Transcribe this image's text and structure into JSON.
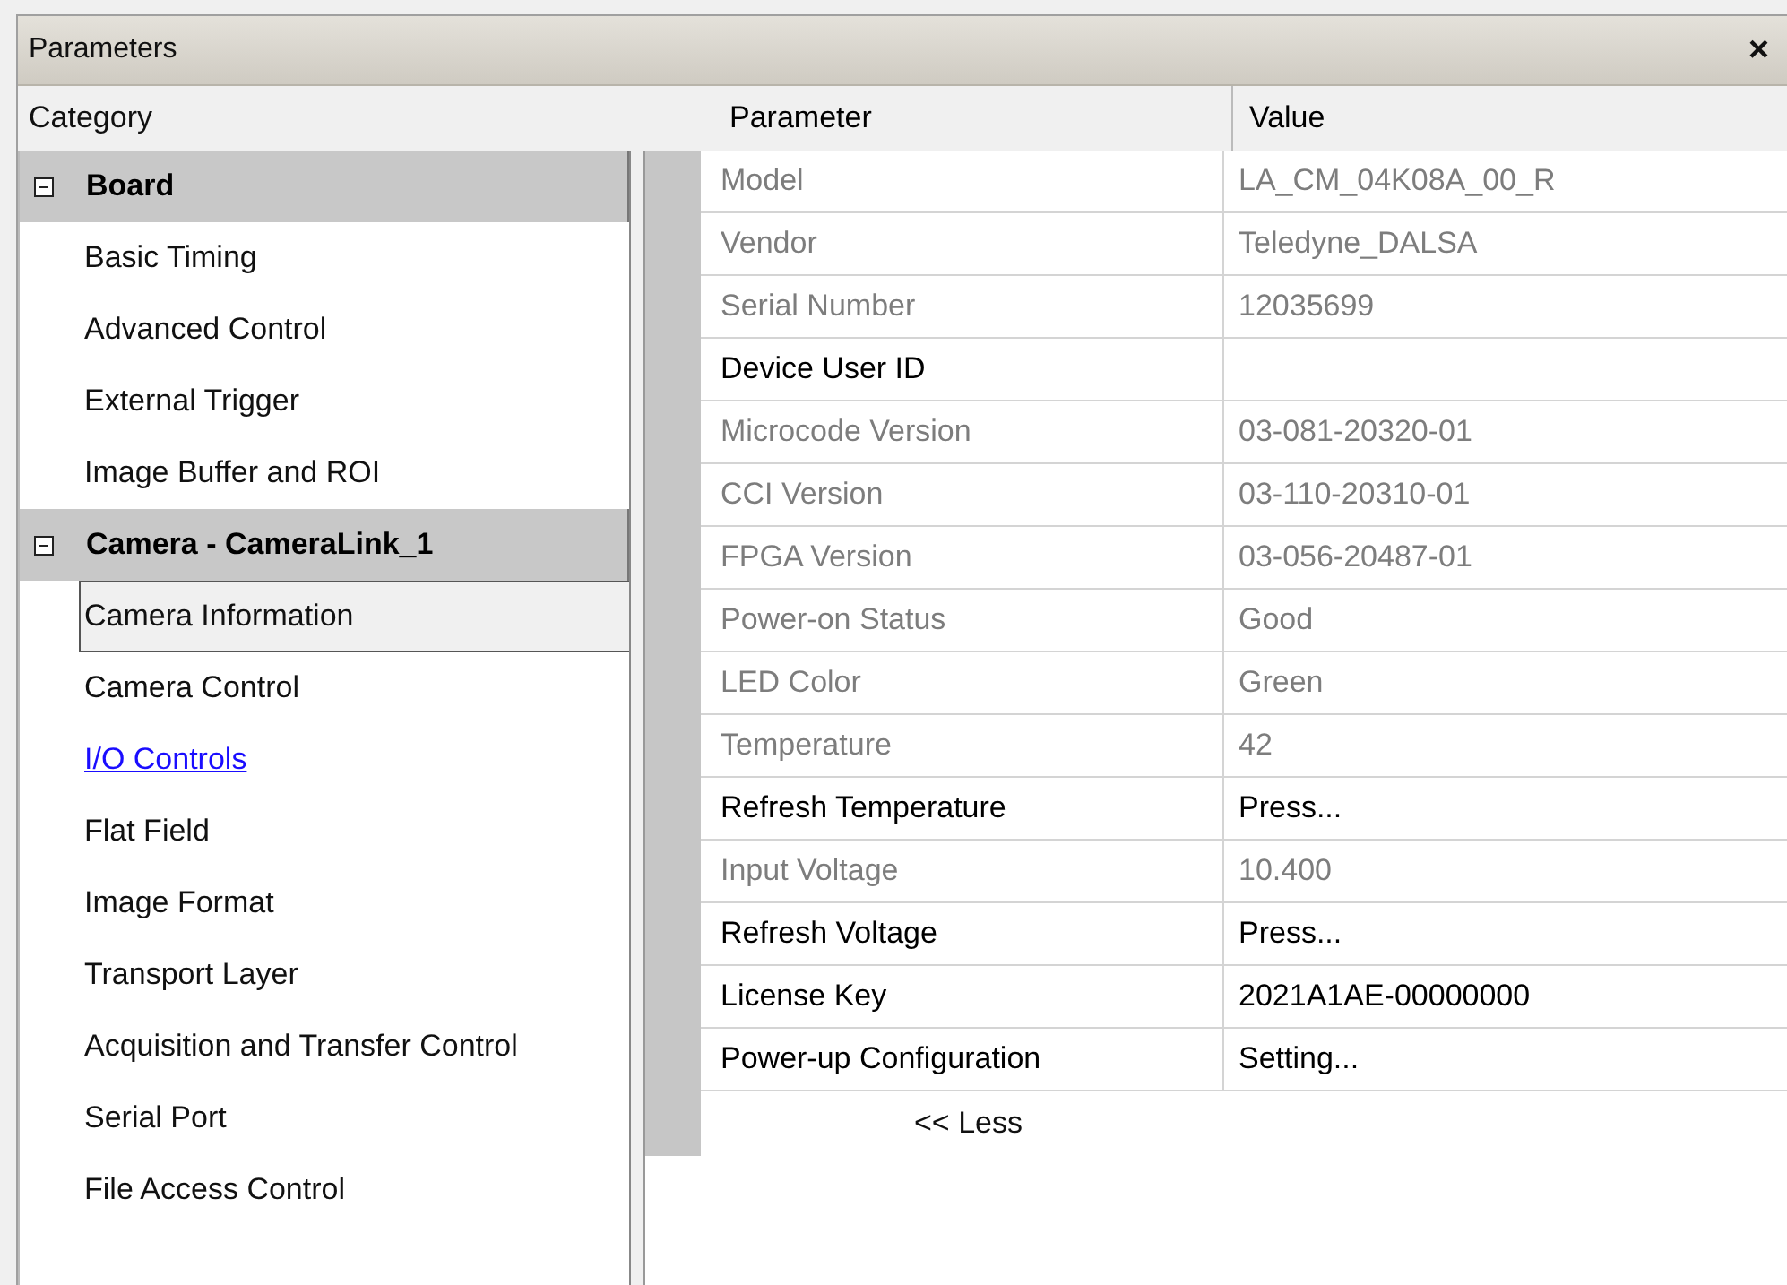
{
  "window": {
    "title": "Parameters",
    "close": "×"
  },
  "category_header": "Category",
  "groups": [
    {
      "label": "Board",
      "expanded": true,
      "items": [
        {
          "label": "Basic Timing",
          "selected": false,
          "hovered": false
        },
        {
          "label": "Advanced Control",
          "selected": false,
          "hovered": false
        },
        {
          "label": "External Trigger",
          "selected": false,
          "hovered": false
        },
        {
          "label": "Image Buffer and ROI",
          "selected": false,
          "hovered": false
        }
      ]
    },
    {
      "label": "Camera - CameraLink_1",
      "expanded": true,
      "items": [
        {
          "label": "Camera Information",
          "selected": true,
          "hovered": false
        },
        {
          "label": "Camera Control",
          "selected": false,
          "hovered": false
        },
        {
          "label": "I/O Controls ",
          "selected": false,
          "hovered": true
        },
        {
          "label": "Flat Field",
          "selected": false,
          "hovered": false
        },
        {
          "label": "Image Format",
          "selected": false,
          "hovered": false
        },
        {
          "label": "Transport Layer",
          "selected": false,
          "hovered": false
        },
        {
          "label": "Acquisition and Transfer Control",
          "selected": false,
          "hovered": false
        },
        {
          "label": "Serial Port",
          "selected": false,
          "hovered": false
        },
        {
          "label": "File Access Control",
          "selected": false,
          "hovered": false
        }
      ]
    }
  ],
  "table": {
    "columns": [
      "Parameter",
      "Value"
    ],
    "rows": [
      {
        "parameter": "Model",
        "value": "LA_CM_04K08A_00_R",
        "readonly": true
      },
      {
        "parameter": "Vendor",
        "value": "Teledyne_DALSA",
        "readonly": true
      },
      {
        "parameter": "Serial Number",
        "value": "12035699",
        "readonly": true
      },
      {
        "parameter": "Device User ID",
        "value": "",
        "readonly": false
      },
      {
        "parameter": "Microcode Version",
        "value": "03-081-20320-01",
        "readonly": true
      },
      {
        "parameter": "CCI Version",
        "value": "03-110-20310-01",
        "readonly": true
      },
      {
        "parameter": "FPGA Version",
        "value": "03-056-20487-01",
        "readonly": true
      },
      {
        "parameter": "Power-on Status",
        "value": "Good",
        "readonly": true
      },
      {
        "parameter": "LED Color",
        "value": "Green",
        "readonly": true
      },
      {
        "parameter": "Temperature",
        "value": "42",
        "readonly": true
      },
      {
        "parameter": "Refresh Temperature",
        "value": "Press...",
        "readonly": false
      },
      {
        "parameter": "Input Voltage",
        "value": "10.400",
        "readonly": true
      },
      {
        "parameter": "Refresh Voltage",
        "value": "Press...",
        "readonly": false
      },
      {
        "parameter": "License Key",
        "value": "2021A1AE-00000000",
        "readonly": false
      },
      {
        "parameter": "Power-up Configuration",
        "value": "Setting...",
        "readonly": false
      }
    ],
    "less_button": "<< Less"
  }
}
